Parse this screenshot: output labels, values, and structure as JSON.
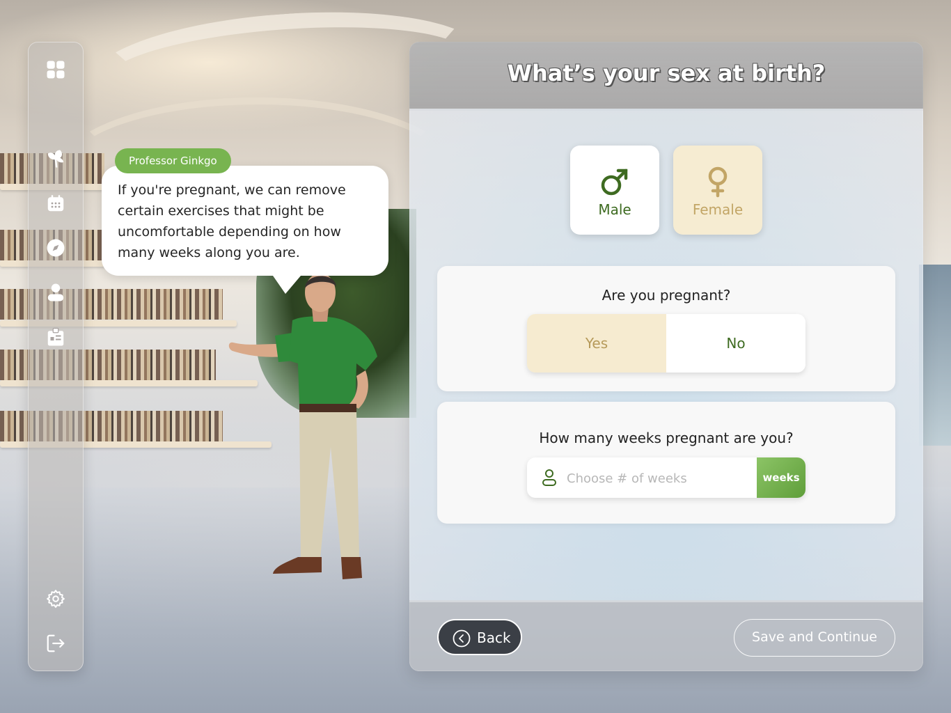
{
  "sidebar": {
    "items": [
      {
        "icon": "dashboard-grid-icon"
      },
      {
        "icon": "ginkgo-leaf-icon"
      },
      {
        "icon": "calendar-icon"
      },
      {
        "icon": "compass-icon"
      },
      {
        "icon": "profile-icon"
      },
      {
        "icon": "clipboard-icon"
      },
      {
        "icon": "gear-icon"
      },
      {
        "icon": "logout-icon"
      }
    ]
  },
  "guide": {
    "name": "Professor Ginkgo",
    "message": "If you're pregnant, we can remove certain exercises that might be uncomfortable depending on how many weeks along you are."
  },
  "question": {
    "title": "What’s your sex at birth?",
    "options": [
      {
        "label": "Male",
        "icon": "male-symbol-icon"
      },
      {
        "label": "Female",
        "icon": "female-symbol-icon",
        "selected": true
      }
    ]
  },
  "pregnancy": {
    "question": "Are you pregnant?",
    "yes_label": "Yes",
    "no_label": "No",
    "selected": "Yes"
  },
  "weeks": {
    "question": "How many weeks pregnant are you?",
    "placeholder": "Choose # of weeks",
    "value": "",
    "unit": "weeks"
  },
  "footer": {
    "back_label": "Back",
    "save_label": "Save and Continue"
  },
  "colors": {
    "accent_green": "#78b450",
    "dark_green": "#3e6b21",
    "selected_cream": "#f6ecd2",
    "selected_text": "#c2a566"
  }
}
